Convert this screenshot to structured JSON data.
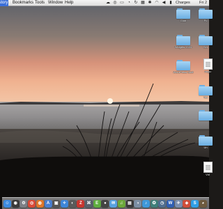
{
  "menubar": {
    "items": [
      "istory",
      "Bookmarks",
      "Tools",
      "Window",
      "Help"
    ],
    "status": {
      "user": "Charges",
      "clock": "Fri 2"
    }
  },
  "desktop": {
    "icons": [
      {
        "label": "Glob",
        "kind": "folder"
      },
      {
        "label": "Pc",
        "kind": "folder"
      },
      {
        "label": "",
        "kind": "folder"
      },
      {
        "label": "Widgets 2024",
        "kind": "folder"
      },
      {
        "label": "Ser",
        "kind": "folder"
      },
      {
        "label": "",
        "kind": "folder"
      },
      {
        "label": "WordPress Stuff",
        "kind": "folder"
      },
      {
        "label": "Augu",
        "kind": "document"
      },
      {
        "label": "Tes",
        "kind": "folder"
      },
      {
        "label": "",
        "kind": "folder"
      },
      {
        "label": "Un",
        "kind": "folder"
      },
      {
        "label": "Vid",
        "kind": "document"
      }
    ]
  },
  "dock": {
    "icons": [
      {
        "name": "finder",
        "glyph": "☺",
        "color": "#3d8be0"
      },
      {
        "name": "dashboard",
        "glyph": "◉",
        "color": "#3a3a3a"
      },
      {
        "name": "system-preferences",
        "glyph": "⚙",
        "color": "#7d7f86"
      },
      {
        "name": "chrome",
        "glyph": "◎",
        "color": "#d94a38"
      },
      {
        "name": "firefox",
        "glyph": "◍",
        "color": "#e0762a"
      },
      {
        "name": "app-store",
        "glyph": "A",
        "color": "#4a7fd0"
      },
      {
        "name": "security",
        "glyph": "▣",
        "color": "#555"
      },
      {
        "name": "safari",
        "glyph": "✧",
        "color": "#3e86d8"
      },
      {
        "name": "photos",
        "glyph": "◐",
        "color": "#5a5a5a"
      },
      {
        "name": "filezilla",
        "glyph": "Z",
        "color": "#c7362f"
      },
      {
        "name": "network",
        "glyph": "⌘",
        "color": "#58606b"
      },
      {
        "name": "evernote",
        "glyph": "E",
        "color": "#5fae3f"
      },
      {
        "name": "camera",
        "glyph": "●",
        "color": "#444"
      },
      {
        "name": "messages",
        "glyph": "✉",
        "color": "#58a2e0"
      },
      {
        "name": "spotify",
        "glyph": "♫",
        "color": "#6ca83a"
      },
      {
        "name": "terminal",
        "glyph": "▤",
        "color": "#3a3a3a"
      },
      {
        "name": "preview",
        "glyph": "◑",
        "color": "#7b8ea3"
      },
      {
        "name": "itunes",
        "glyph": "♪",
        "color": "#3f98d9"
      },
      {
        "name": "compass",
        "glyph": "✪",
        "color": "#3f7f7a"
      },
      {
        "name": "time-machine",
        "glyph": "◷",
        "color": "#4f6d8f"
      },
      {
        "name": "word",
        "glyph": "W",
        "color": "#2f5fb3"
      },
      {
        "name": "mail",
        "glyph": "✈",
        "color": "#7a8fb0"
      },
      {
        "name": "launcher",
        "glyph": "◈",
        "color": "#cf4e3b"
      },
      {
        "name": "skype",
        "glyph": "S",
        "color": "#2f9fe6"
      },
      {
        "name": "lightroom",
        "glyph": "◕",
        "color": "#6e5a3e"
      }
    ]
  }
}
